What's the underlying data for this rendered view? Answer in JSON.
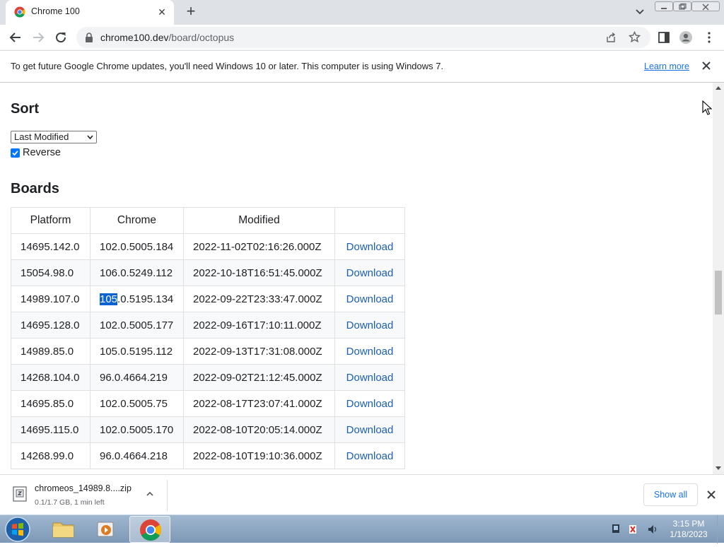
{
  "tab": {
    "title": "Chrome 100"
  },
  "toolbar": {
    "url_host": "chrome100.dev",
    "url_path": "/board/octopus"
  },
  "infobar": {
    "message": "To get future Google Chrome updates, you'll need Windows 10 or later. This computer is using Windows 7.",
    "learn_more": "Learn more"
  },
  "sort": {
    "heading": "Sort",
    "selected": "Last Modified",
    "reverse_label": "Reverse",
    "reverse_checked": true
  },
  "boards": {
    "heading": "Boards",
    "columns": [
      "Platform",
      "Chrome",
      "Modified",
      ""
    ],
    "rows": [
      [
        "14695.142.0",
        "102.0.5005.184",
        "2022-11-02T02:16:26.000Z",
        "Download"
      ],
      [
        "15054.98.0",
        "106.0.5249.112",
        "2022-10-18T16:51:45.000Z",
        "Download"
      ],
      [
        "14989.107.0",
        "105.0.5195.134",
        "2022-09-22T23:33:47.000Z",
        "Download"
      ],
      [
        "14695.128.0",
        "102.0.5005.177",
        "2022-09-16T17:10:11.000Z",
        "Download"
      ],
      [
        "14989.85.0",
        "105.0.5195.112",
        "2022-09-13T17:31:08.000Z",
        "Download"
      ],
      [
        "14268.104.0",
        "96.0.4664.219",
        "2022-09-02T21:12:45.000Z",
        "Download"
      ],
      [
        "14695.85.0",
        "102.0.5005.75",
        "2022-08-17T23:07:41.000Z",
        "Download"
      ],
      [
        "14695.115.0",
        "102.0.5005.170",
        "2022-08-10T20:05:14.000Z",
        "Download"
      ],
      [
        "14268.99.0",
        "96.0.4664.218",
        "2022-08-10T19:10:36.000Z",
        "Download"
      ]
    ],
    "selected_text": {
      "row": 2,
      "col": 1,
      "selected": "105",
      "rest": ".0.5195.134"
    }
  },
  "download": {
    "filename": "chromeos_14989.8....zip",
    "status": "0.1/1.7 GB, 1 min left",
    "show_all": "Show all"
  },
  "taskbar": {
    "time": "3:15 PM",
    "date": "1/18/2023"
  },
  "colors": {
    "accent": "#1a73e8",
    "link": "#1a5fb4",
    "selection": "#0b62d3",
    "tabstrip": "#dee1e6"
  }
}
